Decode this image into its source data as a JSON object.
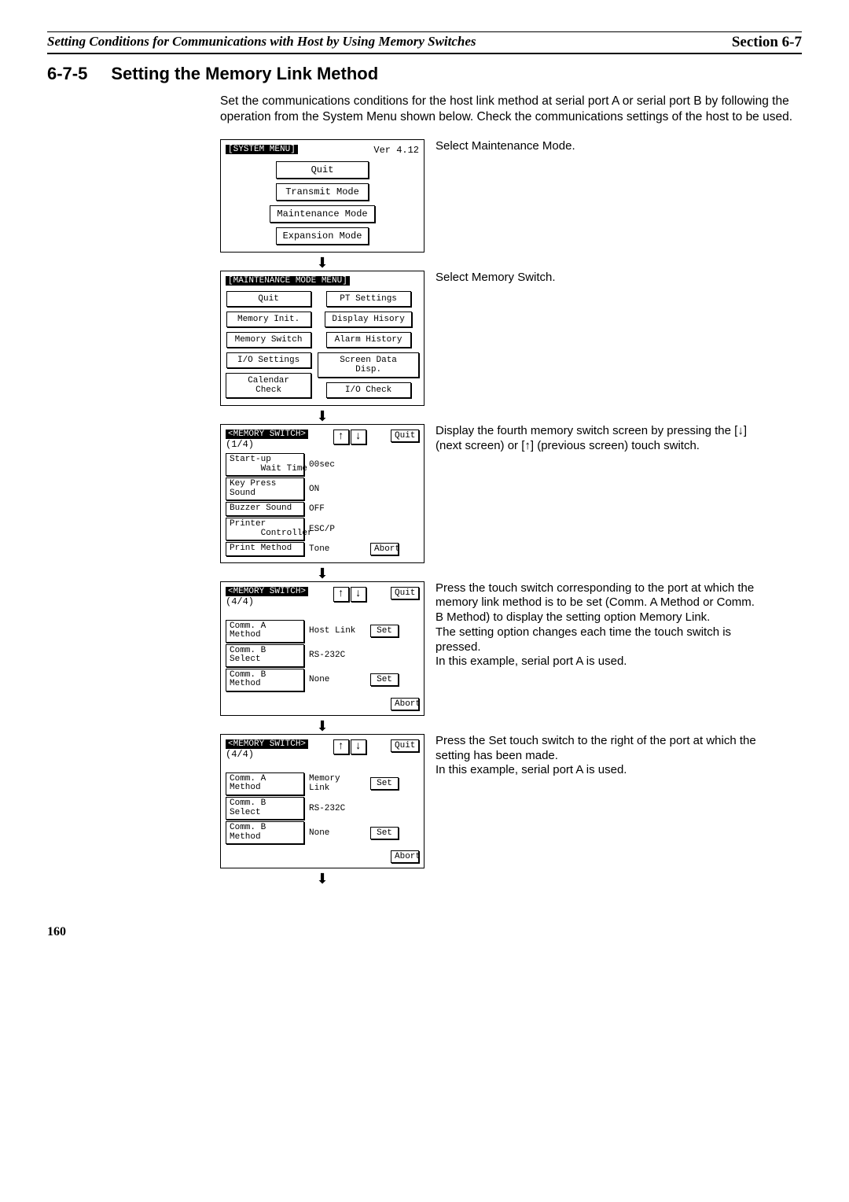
{
  "header": {
    "left": "Setting Conditions for Communications with Host by Using Memory Switches",
    "right": "Section 6-7"
  },
  "section": {
    "num": "6-7-5",
    "title": "Setting the Memory Link Method"
  },
  "intro": "Set the communications conditions for the host link method at serial port A or serial port B by following the operation from the System Menu shown below. Check the communications settings of the host to be used.",
  "screens": {
    "s1": {
      "title": "[SYSTEM MENU]",
      "ver": "Ver 4.12",
      "items": [
        "Quit",
        "Transmit Mode",
        "Maintenance Mode",
        "Expansion Mode"
      ],
      "desc": "Select Maintenance Mode."
    },
    "s2": {
      "title": "[MAINTENANCE MODE MENU]",
      "left": [
        "Quit",
        "Memory Init.",
        "Memory Switch",
        "I/O Settings",
        "Calendar Check"
      ],
      "right": [
        "PT Settings",
        "Display Hisory",
        "Alarm History",
        "Screen Data Disp.",
        "I/O Check"
      ],
      "desc": "Select Memory Switch."
    },
    "s3": {
      "title": "<MEMORY SWITCH>",
      "page": "(1/4)",
      "quit": "Quit",
      "rows": [
        {
          "label": "Start-up\n      Wait Time",
          "val": "00sec"
        },
        {
          "label": "Key Press Sound",
          "val": "ON"
        },
        {
          "label": "Buzzer Sound",
          "val": "OFF"
        },
        {
          "label": "Printer\n      Controller",
          "val": "ESC/P"
        },
        {
          "label": "Print Method",
          "val": "Tone",
          "btn": "Abort"
        }
      ],
      "desc": "Display the fourth memory switch screen by pressing the [↓] (next screen) or [↑] (previous screen) touch switch."
    },
    "s4": {
      "title": "<MEMORY SWITCH>",
      "page": "(4/4)",
      "quit": "Quit",
      "rows": [
        {
          "label": "Comm. A Method",
          "val": "Host Link",
          "btn": "Set"
        },
        {
          "label": "Comm. B Select",
          "val": "RS-232C"
        },
        {
          "label": "Comm. B Method",
          "val": "None",
          "btn": "Set"
        }
      ],
      "abort": "Abort",
      "desc": "Press the touch switch corresponding to the port at which the memory link method is to be set (Comm. A Method or Comm. B Method) to display the setting option Memory Link.\nThe setting option changes each time the touch switch is pressed.\nIn this example, serial port A is used."
    },
    "s5": {
      "title": "<MEMORY SWITCH>",
      "page": "(4/4)",
      "quit": "Quit",
      "rows": [
        {
          "label": "Comm. A Method",
          "val": "Memory Link",
          "btn": "Set"
        },
        {
          "label": "Comm. B Select",
          "val": "RS-232C"
        },
        {
          "label": "Comm. B Method",
          "val": "None",
          "btn": "Set"
        }
      ],
      "abort": "Abort",
      "desc": "Press the Set touch switch to the right of the port at which the setting has been made.\nIn this example, serial port A is used."
    }
  },
  "pageNum": "160"
}
